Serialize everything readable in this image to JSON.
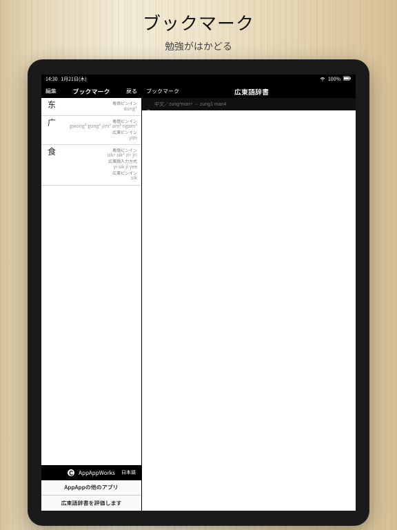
{
  "hero": {
    "title": "ブックマーク",
    "subtitle": "勉強がはかどる"
  },
  "status": {
    "time": "14:30",
    "date": "1月21日(木)",
    "battery": "100%"
  },
  "left": {
    "nav": {
      "edit": "編集",
      "title": "ブックマーク",
      "back": "戻る"
    },
    "entries": [
      {
        "char": "东",
        "lines": [
          {
            "label": "粤語ピンイン",
            "val": "dung¹"
          }
        ]
      },
      {
        "char": "广",
        "lines": [
          {
            "label": "粤語ピンイン",
            "val": "gwong² gong² jim² am² ngam²"
          },
          {
            "label": "広東ピンイン",
            "val": "yim"
          }
        ]
      },
      {
        "char": "食",
        "lines": [
          {
            "label": "粤語ピンイン",
            "val": "sik⁶ sik² zi⁶ ji⁶"
          },
          {
            "label": "広東語入力方式",
            "val": "yi sik ji yee"
          },
          {
            "label": "広東ピンイン",
            "val": "sik"
          }
        ]
      }
    ],
    "footer": {
      "brand": "AppAppWorks",
      "lang": "日本語",
      "row1": "AppAppの他のアプリ",
      "row2": "広東語辞書を評価します"
    }
  },
  "right": {
    "nav": {
      "bookmark": "ブックマーク",
      "title": "広東語辞書"
    },
    "search": {
      "placeholder": "中文／zung¹man⁴ → zung1 man4"
    }
  }
}
